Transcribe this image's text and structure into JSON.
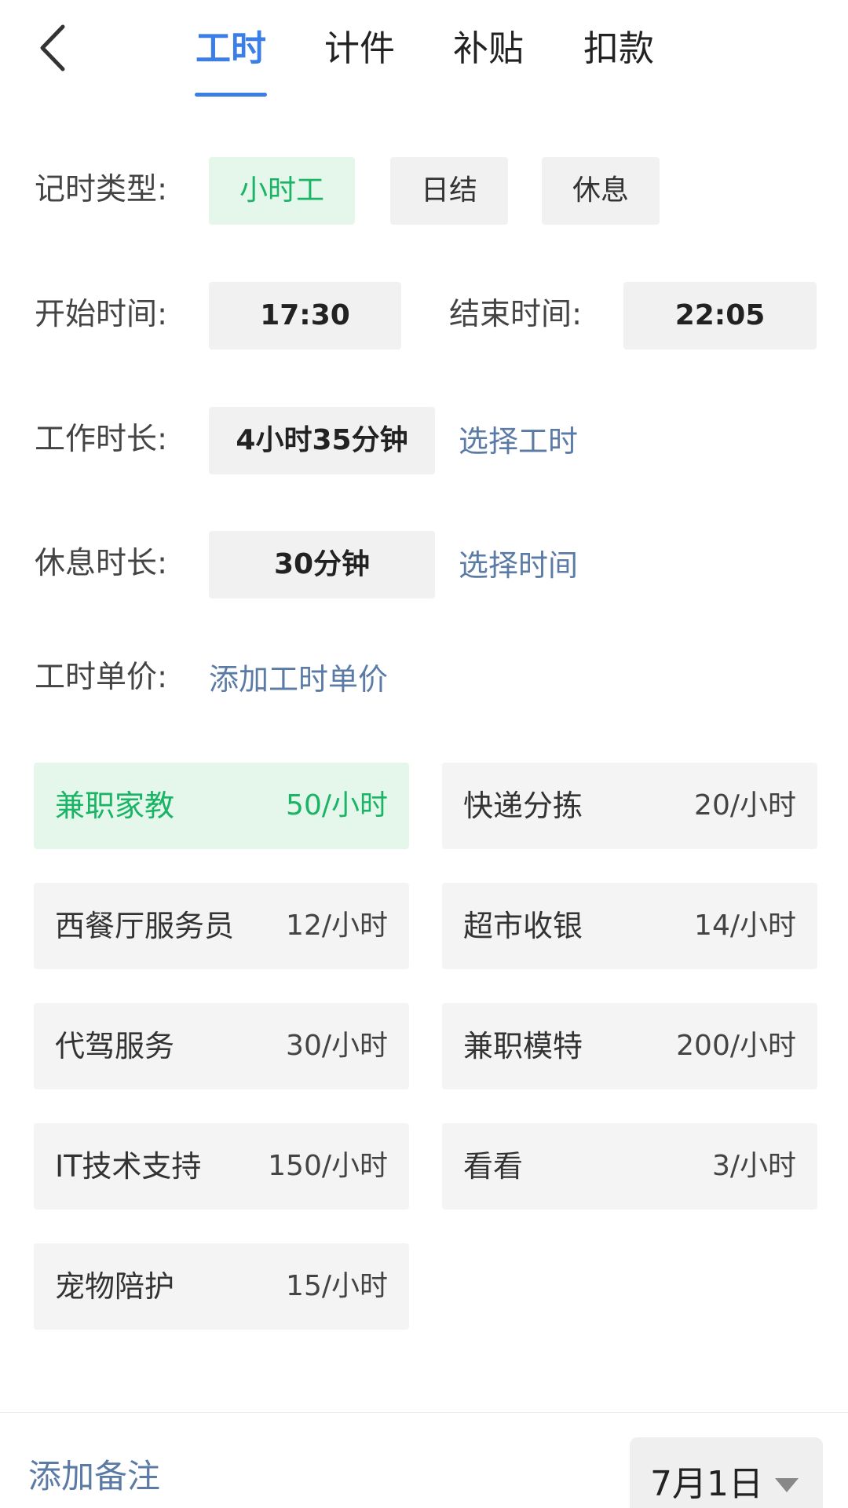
{
  "tabs": [
    {
      "label": "工时",
      "active": true
    },
    {
      "label": "计件",
      "active": false
    },
    {
      "label": "补贴",
      "active": false
    },
    {
      "label": "扣款",
      "active": false
    }
  ],
  "record_type": {
    "label": "记时类型:",
    "options": [
      {
        "label": "小时工",
        "selected": true
      },
      {
        "label": "日结",
        "selected": false
      },
      {
        "label": "休息",
        "selected": false
      }
    ]
  },
  "start_time": {
    "label": "开始时间:",
    "value": "17:30"
  },
  "end_time": {
    "label": "结束时间:",
    "value": "22:05"
  },
  "work_duration": {
    "label": "工作时长:",
    "value": "4小时35分钟",
    "action": "选择工时"
  },
  "rest_duration": {
    "label": "休息时长:",
    "value": "30分钟",
    "action": "选择时间"
  },
  "unit_price": {
    "label": "工时单价:",
    "action": "添加工时单价"
  },
  "price_items": [
    {
      "name": "兼职家教",
      "rate": "50/小时",
      "selected": true
    },
    {
      "name": "快递分拣",
      "rate": "20/小时",
      "selected": false
    },
    {
      "name": "西餐厅服务员",
      "rate": "12/小时",
      "selected": false
    },
    {
      "name": "超市收银",
      "rate": "14/小时",
      "selected": false
    },
    {
      "name": "代驾服务",
      "rate": "30/小时",
      "selected": false
    },
    {
      "name": "兼职模特",
      "rate": "200/小时",
      "selected": false
    },
    {
      "name": "IT技术支持",
      "rate": "150/小时",
      "selected": false
    },
    {
      "name": "看看",
      "rate": "3/小时",
      "selected": false
    },
    {
      "name": "宠物陪护",
      "rate": "15/小时",
      "selected": false
    }
  ],
  "footer": {
    "note_label": "添加备注",
    "date": "7月1日"
  },
  "colors": {
    "accent_blue": "#3a7ee6",
    "accent_green": "#19b466",
    "link": "#5b7ba6"
  },
  "icons": {
    "back": "chevron-left-icon",
    "date_caret": "caret-down-icon"
  }
}
